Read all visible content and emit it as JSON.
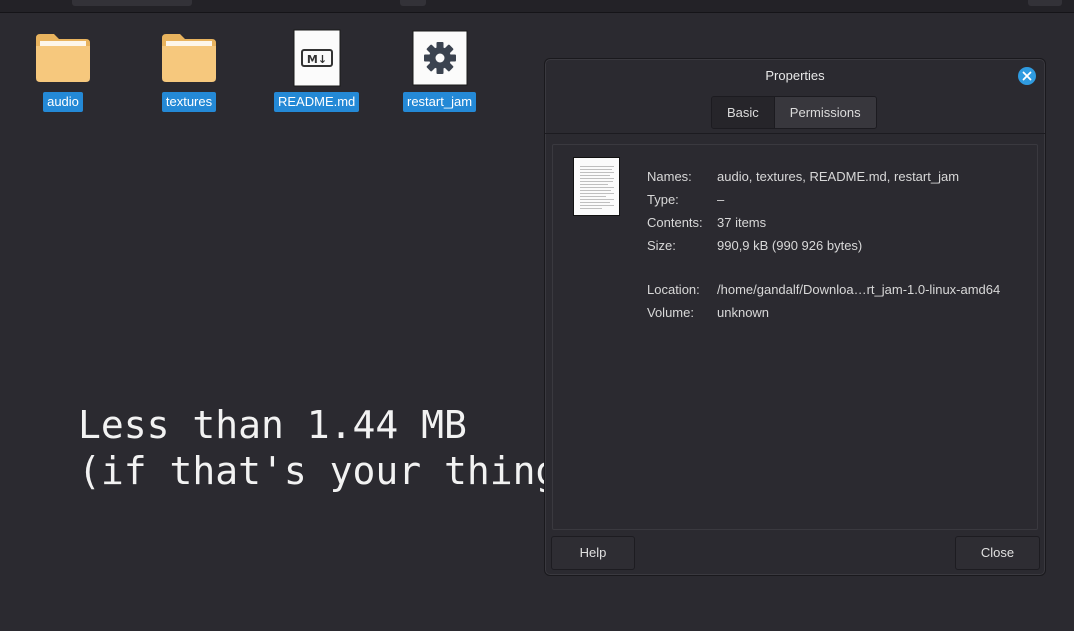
{
  "desktop": {
    "icons": [
      {
        "label": "audio",
        "icon": "folder-icon"
      },
      {
        "label": "textures",
        "icon": "folder-icon"
      },
      {
        "label": "README.md",
        "icon": "markdown-file-icon",
        "badge": "M↓"
      },
      {
        "label": "restart_jam",
        "icon": "gear-executable-icon"
      }
    ],
    "overlay_lines": [
      "Less than 1.44 MB",
      "(if that's your thing)"
    ]
  },
  "dialog": {
    "title": "Properties",
    "tabs": [
      {
        "label": "Basic",
        "active": false
      },
      {
        "label": "Permissions",
        "active": true
      }
    ],
    "properties": [
      {
        "label": "Names:",
        "value": "audio, textures, README.md, restart_jam"
      },
      {
        "label": "Type:",
        "value": "–"
      },
      {
        "label": "Contents:",
        "value": "37 items"
      },
      {
        "label": "Size:",
        "value": "990,9 kB (990 926 bytes)"
      },
      {
        "label": "Location:",
        "value": "/home/gandalf/Downloa…rt_jam-1.0-linux-amd64"
      },
      {
        "label": "Volume:",
        "value": "unknown"
      }
    ],
    "buttons": {
      "help": "Help",
      "close": "Close"
    }
  },
  "colors": {
    "background": "#2b2a30",
    "selection": "#2489d6",
    "folder": "#f6c87d",
    "close_button": "#2f9be0"
  }
}
